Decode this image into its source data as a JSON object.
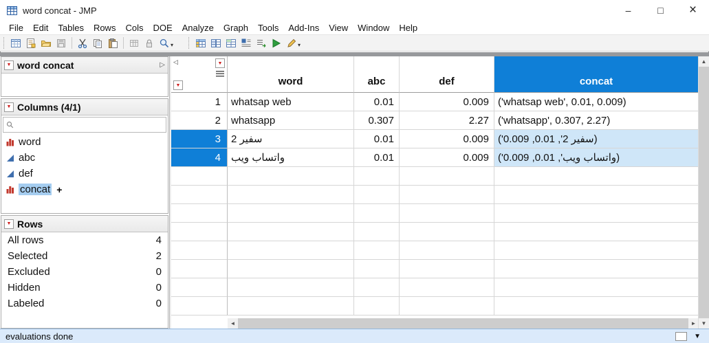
{
  "window": {
    "title": "word concat - JMP",
    "controls": {
      "minimize": "–",
      "maximize": "□",
      "close": "×"
    }
  },
  "menubar": {
    "items": [
      "File",
      "Edit",
      "Tables",
      "Rows",
      "Cols",
      "DOE",
      "Analyze",
      "Graph",
      "Tools",
      "Add-Ins",
      "View",
      "Window",
      "Help"
    ]
  },
  "toolbar": {
    "icons": [
      "new-data-table",
      "new-journal",
      "open",
      "save",
      "cut",
      "copy",
      "paste",
      "copy-table",
      "lock",
      "zoom",
      "data-table",
      "split-columns",
      "stack-columns",
      "manage-views",
      "recode",
      "run-script",
      "formula-editor"
    ]
  },
  "sidebar": {
    "table_panel": {
      "title": "word concat"
    },
    "columns_panel": {
      "title": "Columns (4/1)",
      "search_value": "",
      "items": [
        {
          "label": "word",
          "icon": "continuous-bars-red",
          "selected": false
        },
        {
          "label": "abc",
          "icon": "continuous-triangle-blue",
          "selected": false
        },
        {
          "label": "def",
          "icon": "continuous-triangle-blue",
          "selected": false
        },
        {
          "label": "concat",
          "icon": "continuous-bars-red",
          "selected": true,
          "formula_indicator": "+"
        }
      ]
    },
    "rows_panel": {
      "title": "Rows",
      "stats": [
        {
          "label": "All rows",
          "value": "4"
        },
        {
          "label": "Selected",
          "value": "2"
        },
        {
          "label": "Excluded",
          "value": "0"
        },
        {
          "label": "Hidden",
          "value": "0"
        },
        {
          "label": "Labeled",
          "value": "0"
        }
      ]
    }
  },
  "table": {
    "columns": [
      {
        "label": "word"
      },
      {
        "label": "abc"
      },
      {
        "label": "def"
      },
      {
        "label": "concat",
        "selected": true
      }
    ],
    "rows": [
      {
        "n": "1",
        "word": "whatsap web",
        "abc": "0.01",
        "def": "0.009",
        "concat": "('whatsap web', 0.01, 0.009)",
        "selected": false
      },
      {
        "n": "2",
        "word": "whatsapp",
        "abc": "0.307",
        "def": "2.27",
        "concat": "('whatsapp', 0.307, 2.27)",
        "selected": false
      },
      {
        "n": "3",
        "word": "سفير 2",
        "abc": "0.01",
        "def": "0.009",
        "concat": "('سفير 2', 0.01, 0.009)",
        "selected": true
      },
      {
        "n": "4",
        "word": "واتساب ويب",
        "abc": "0.01",
        "def": "0.009",
        "concat": "('واتساب ويب', 0.01, 0.009)",
        "selected": true
      }
    ],
    "empty_row_count": 8
  },
  "statusbar": {
    "text": "evaluations done"
  },
  "colors": {
    "selection_blue": "#0f7fd7",
    "selected_cell_blue": "#cfe6f8",
    "statusbar_blue": "#dbeafb"
  }
}
